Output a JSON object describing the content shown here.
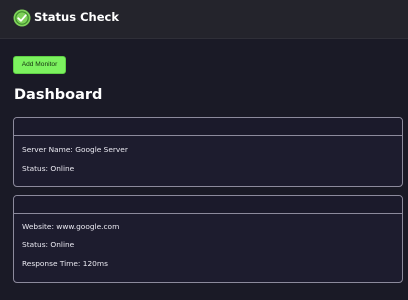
{
  "app": {
    "title": "Status Check",
    "logo_icon": "status-check-logo-icon"
  },
  "toolbar": {
    "add_monitor_label": "Add Monitor"
  },
  "main": {
    "heading": "Dashboard"
  },
  "cards": [
    {
      "lines": [
        "Server Name: Google Server",
        "Status: Online"
      ]
    },
    {
      "lines": [
        "Website: www.google.com",
        "Status: Online",
        "Response Time: 120ms"
      ]
    }
  ],
  "colors": {
    "accent": "#7cf25f",
    "background": "#1a1a26",
    "topbar": "#24242c",
    "card": "#1d1c2e",
    "card_border": "#8c8a9c"
  }
}
